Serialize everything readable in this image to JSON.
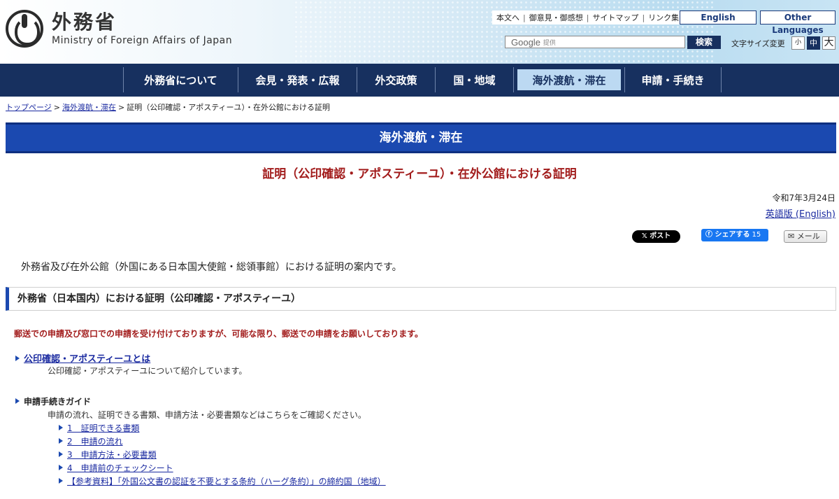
{
  "header": {
    "logo_ja": "外務省",
    "logo_en": "Ministry of Foreign Affairs of Japan",
    "util_links": [
      "本文へ",
      "御意見・御感想",
      "サイトマップ",
      "リンク集"
    ],
    "english": "English",
    "other_languages": "Other Languages",
    "search_brand": "Google",
    "search_provided": "提供",
    "search_button": "検索",
    "fontsize_label": "文字サイズ変更",
    "fontsize_small": "小",
    "fontsize_medium": "中",
    "fontsize_large": "大"
  },
  "gnav": {
    "items": [
      "外務省について",
      "会見・発表・広報",
      "外交政策",
      "国・地域",
      "海外渡航・滞在",
      "申請・手続き"
    ],
    "active_index": 4
  },
  "breadcrumb": {
    "home": "トップページ",
    "section": "海外渡航・滞在",
    "current": "証明（公印確認・アポスティーユ）・在外公館における証明"
  },
  "banner": "海外渡航・滞在",
  "page_title": "証明（公印確認・アポスティーユ）・在外公館における証明",
  "date": "令和7年3月24日",
  "english_version": "英語版 (English)",
  "share": {
    "x_post": "𝕏 ポスト",
    "fb_label": "シェアする",
    "fb_count": "15",
    "mail": "メール"
  },
  "intro": "外務省及び在外公館（外国にある日本国大使館・総領事館）における証明の案内です。",
  "section_heading": "外務省（日本国内）における証明（公印確認・アポスティーユ）",
  "notice": "郵送での申請及び窓口での申請を受け付けておりますが、可能な限り、郵送での申請をお願いしております。",
  "items": {
    "about_link": "公印確認・アポスティーユとは",
    "about_desc": "公印確認・アポスティーユについて紹介しています。",
    "guide_title": "申請手続きガイド",
    "guide_desc": "申請の流れ、証明できる書類、申請方法・必要書類などはこちらをご確認ください。",
    "guide_links": [
      "1　証明できる書類",
      "2　申請の流れ",
      "3　申請方法・必要書類",
      "4　申請前のチェックシート",
      "【参考資料】「外国公文書の認証を不要とする条約（ハーグ条約）」の締約国（地域）"
    ]
  }
}
